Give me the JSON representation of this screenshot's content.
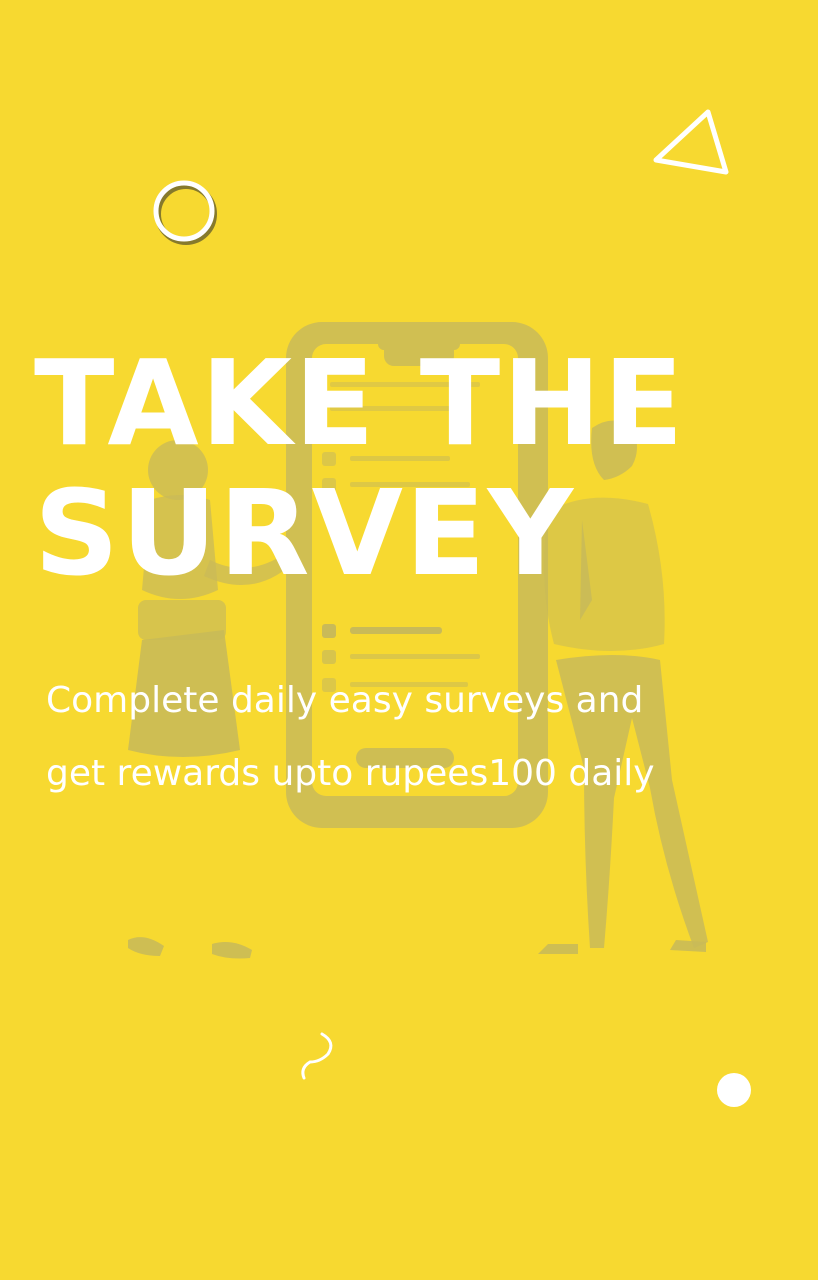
{
  "screen": {
    "background_color": "#f7d930",
    "accent_color": "#ffffff",
    "illustration_color": "#c9ba58"
  },
  "headline": {
    "line1": "TAKE THE",
    "line2": "SURVEY"
  },
  "subtitle": {
    "text": "Complete daily easy surveys and get rewards upto rupees100 daily"
  },
  "decorations": {
    "icons": [
      "circle-outline-icon",
      "triangle-outline-icon",
      "squiggle-icon",
      "dot-icon"
    ]
  },
  "illustration": {
    "description_icon": "phone-survey-illustration"
  }
}
